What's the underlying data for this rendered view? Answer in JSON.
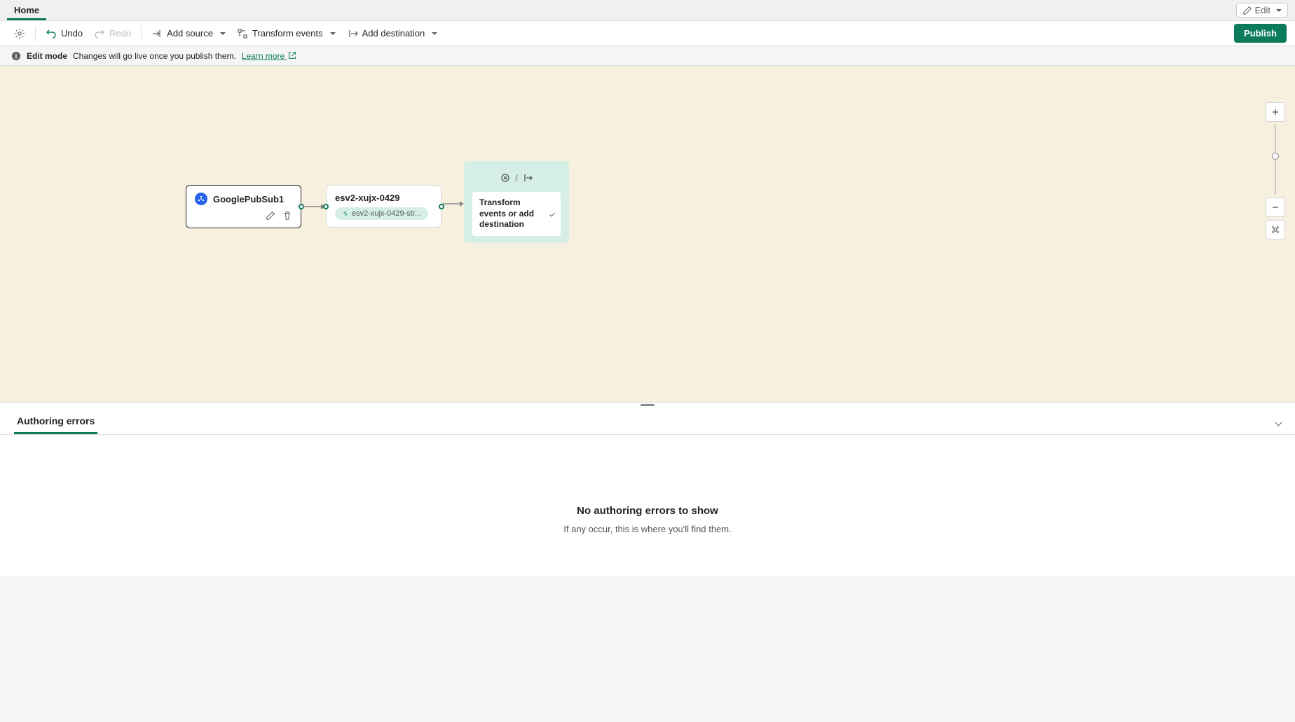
{
  "tabs": {
    "home": "Home",
    "edit_dropdown": "Edit"
  },
  "toolbar": {
    "undo": "Undo",
    "redo": "Redo",
    "add_source": "Add source",
    "transform_events": "Transform events",
    "add_destination": "Add destination",
    "publish": "Publish"
  },
  "info": {
    "mode": "Edit mode",
    "message": "Changes will go live once you publish them.",
    "link": "Learn more"
  },
  "nodes": {
    "source": {
      "title": "GooglePubSub1"
    },
    "stream": {
      "title": "esv2-xujx-0429",
      "chip": "esv2-xujx-0429-str..."
    },
    "placeholder": {
      "text": "Transform events or add destination"
    }
  },
  "panel": {
    "tab": "Authoring errors",
    "empty_title": "No authoring errors to show",
    "empty_sub": "If any occur, this is where you'll find them."
  }
}
